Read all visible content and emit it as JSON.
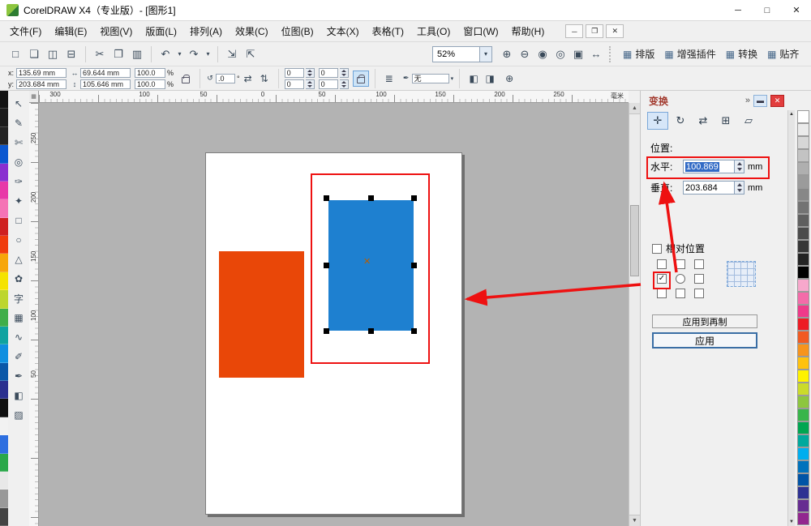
{
  "colors": {
    "annotation": "#ee1111",
    "selection": "#316ac5",
    "blue-shape": "#1e80d0",
    "orange-shape": "#e94708",
    "docker-title": "#a23a2e",
    "apply-border": "#3a6ea5",
    "canvas-bg": "#b3b3b3"
  },
  "titlebar": {
    "title": "CorelDRAW X4（专业版）- [图形1]",
    "minimize_glyph": "─",
    "maximize_glyph": "□",
    "close_glyph": "✕"
  },
  "menubar": {
    "items": [
      {
        "name": "menu-file",
        "label": "文件(F)"
      },
      {
        "name": "menu-edit",
        "label": "编辑(E)"
      },
      {
        "name": "menu-view",
        "label": "视图(V)"
      },
      {
        "name": "menu-layout",
        "label": "版面(L)"
      },
      {
        "name": "menu-arrange",
        "label": "排列(A)"
      },
      {
        "name": "menu-effects",
        "label": "效果(C)"
      },
      {
        "name": "menu-bitmaps",
        "label": "位图(B)"
      },
      {
        "name": "menu-text",
        "label": "文本(X)"
      },
      {
        "name": "menu-table",
        "label": "表格(T)"
      },
      {
        "name": "menu-tools",
        "label": "工具(O)"
      },
      {
        "name": "menu-window",
        "label": "窗口(W)"
      },
      {
        "name": "menu-help",
        "label": "帮助(H)"
      }
    ],
    "doc_controls": [
      {
        "name": "doc-minimize-button",
        "glyph": "─"
      },
      {
        "name": "doc-restore-button",
        "glyph": "❐"
      },
      {
        "name": "doc-close-button",
        "glyph": "✕"
      }
    ]
  },
  "toolbar": {
    "items": [
      {
        "name": "new-button",
        "glyph": "□",
        "cls": "tbtn",
        "inter": "true"
      },
      {
        "name": "open-button",
        "glyph": "❏",
        "cls": "tbtn",
        "inter": "true"
      },
      {
        "name": "save-button",
        "glyph": "◫",
        "cls": "tbtn",
        "inter": "true"
      },
      {
        "name": "print-button",
        "glyph": "⊟",
        "cls": "tbtn",
        "inter": "true"
      },
      {
        "name": "toolbar-separator",
        "glyph": "",
        "cls": "tsep",
        "inter": "false"
      },
      {
        "name": "cut-button",
        "glyph": "✂",
        "cls": "tbtn",
        "inter": "true"
      },
      {
        "name": "copy-button",
        "glyph": "❐",
        "cls": "tbtn",
        "inter": "true"
      },
      {
        "name": "paste-button",
        "glyph": "▥",
        "cls": "tbtn",
        "inter": "true"
      },
      {
        "name": "toolbar-separator",
        "glyph": "",
        "cls": "tsep",
        "inter": "false"
      },
      {
        "name": "undo-button",
        "glyph": "↶",
        "cls": "tbtn",
        "inter": "true"
      },
      {
        "name": "undo-caret",
        "glyph": "▾",
        "cls": "tbtn narrow",
        "inter": "true"
      },
      {
        "name": "redo-button",
        "glyph": "↷",
        "cls": "tbtn",
        "inter": "true"
      },
      {
        "name": "redo-caret",
        "glyph": "▾",
        "cls": "tbtn narrow",
        "inter": "true"
      },
      {
        "name": "toolbar-separator",
        "glyph": "",
        "cls": "tsep",
        "inter": "false"
      },
      {
        "name": "import-button",
        "glyph": "⇲",
        "cls": "tbtn",
        "inter": "true"
      },
      {
        "name": "export-button",
        "glyph": "⇱",
        "cls": "tbtn",
        "inter": "true"
      }
    ],
    "zoom_value": "52%",
    "zoom_items": [
      {
        "name": "zoom-in-button",
        "glyph": "⊕"
      },
      {
        "name": "zoom-out-button",
        "glyph": "⊖"
      },
      {
        "name": "zoom-actual-button",
        "glyph": "◉"
      },
      {
        "name": "zoom-selected-button",
        "glyph": "◎"
      },
      {
        "name": "zoom-page-button",
        "glyph": "▣"
      },
      {
        "name": "zoom-width-button",
        "glyph": "↔"
      }
    ],
    "text_buttons": [
      {
        "name": "layout-button",
        "label": "排版",
        "glyph": "▦"
      },
      {
        "name": "plugins-button",
        "label": "增强插件",
        "glyph": "▦"
      },
      {
        "name": "convert-button",
        "label": "转换",
        "glyph": "▦"
      },
      {
        "name": "snap-button",
        "label": "贴齐",
        "glyph": "▦"
      }
    ]
  },
  "property_bar": {
    "x_label": "x:",
    "x_value": "135.69 mm",
    "y_label": "y:",
    "y_value": "203.684 mm",
    "width_icon": "↔",
    "width_value": "69.644 mm",
    "height_icon": "↕",
    "height_value": "105.646 mm",
    "scale_h": "100.0",
    "scale_v": "100.0",
    "percent": "%",
    "angle_icon": "↺",
    "angle_value": ".0",
    "degree": "°",
    "mirror_h_glyph": "⇄",
    "mirror_v_glyph": "⇅",
    "corner_values": [
      "0",
      "0",
      "0",
      "0"
    ],
    "wrap_glyph": "≣",
    "outline_pen_glyph": "✒",
    "outline_value": "无",
    "fill_glyph": "◧",
    "outline_color_glyph": "◨",
    "quick_glyph": "⊕"
  },
  "toolbox": {
    "tools": [
      {
        "name": "pick-tool",
        "glyph": "↖"
      },
      {
        "name": "shape-tool",
        "glyph": "✎"
      },
      {
        "name": "crop-tool",
        "glyph": "✄"
      },
      {
        "name": "zoom-tool",
        "glyph": "◎"
      },
      {
        "name": "freehand-tool",
        "glyph": "✑"
      },
      {
        "name": "smart-fill-tool",
        "glyph": "✦"
      },
      {
        "name": "rectangle-tool",
        "glyph": "□"
      },
      {
        "name": "ellipse-tool",
        "glyph": "○"
      },
      {
        "name": "polygon-tool",
        "glyph": "△"
      },
      {
        "name": "basic-shapes-tool",
        "glyph": "✿"
      },
      {
        "name": "text-tool",
        "glyph": "字"
      },
      {
        "name": "table-tool",
        "glyph": "▦"
      },
      {
        "name": "blend-tool",
        "glyph": "∿"
      },
      {
        "name": "eyedropper-tool",
        "glyph": "✐"
      },
      {
        "name": "outline-tool",
        "glyph": "✒"
      },
      {
        "name": "fill-tool",
        "glyph": "◧"
      },
      {
        "name": "interactive-fill-tool",
        "glyph": "▨"
      }
    ]
  },
  "rulers": {
    "h_labels": [
      "100",
      "50",
      "0",
      "50",
      "100",
      "150",
      "200",
      "250",
      "300"
    ],
    "v_labels": [
      "250",
      "200",
      "150",
      "100",
      "50"
    ],
    "unit": "毫米"
  },
  "docker": {
    "title": "变换",
    "chevron": "»",
    "minimize_glyph": "▬",
    "close_glyph": "✕",
    "tools": [
      {
        "name": "transform-position-button",
        "glyph": "✛",
        "cls": "dtool active"
      },
      {
        "name": "transform-rotate-button",
        "glyph": "↻",
        "cls": "dtool"
      },
      {
        "name": "transform-scale-mirror-button",
        "glyph": "⇄",
        "cls": "dtool"
      },
      {
        "name": "transform-size-button",
        "glyph": "⊞",
        "cls": "dtool"
      },
      {
        "name": "transform-skew-button",
        "glyph": "▱",
        "cls": "dtool"
      }
    ],
    "position_label": "位置:",
    "h_label": "水平:",
    "h_value": "100.869",
    "h_unit": "mm",
    "v_label": "垂直:",
    "v_value": "203.684",
    "v_unit": "mm",
    "relative_label": "相对位置",
    "anchor_cells": [
      {
        "cls": "acell cb",
        "mark": ""
      },
      {
        "cls": "acell cb",
        "mark": ""
      },
      {
        "cls": "acell cb",
        "mark": ""
      },
      {
        "cls": "acell cb checked",
        "mark": "✓"
      },
      {
        "cls": "acell radio",
        "mark": ""
      },
      {
        "cls": "acell cb",
        "mark": ""
      },
      {
        "cls": "acell cb",
        "mark": ""
      },
      {
        "cls": "acell cb",
        "mark": ""
      },
      {
        "cls": "acell cb",
        "mark": ""
      }
    ],
    "apply_duplicate_label": "应用到再制",
    "apply_label": "应用"
  },
  "palettes": {
    "left": [
      "#141414",
      "#1c1c1c",
      "#242424",
      "#0a57d0",
      "#8a2fd0",
      "#e838a8",
      "#f573b5",
      "#cf2020",
      "#f03c0c",
      "#f7a60a",
      "#f5e300",
      "#bdd62e",
      "#3fae49",
      "#0fa3a0",
      "#0f8fe0",
      "#0a57a8",
      "#2a2f8f",
      "#101010",
      "#f2f2f2",
      "#2e6fe0",
      "#2aa84a",
      "#e8e8e8",
      "#999999",
      "#444444"
    ],
    "right": [
      "#ffffff",
      "#ebebeb",
      "#d7d7d7",
      "#c3c3c3",
      "#afafaf",
      "#9b9b9b",
      "#878787",
      "#737373",
      "#5f5f5f",
      "#4b4b4b",
      "#373737",
      "#232323",
      "#000000",
      "#f7a8cc",
      "#f46ba9",
      "#ef3a8a",
      "#ed1c24",
      "#f15a22",
      "#f7941d",
      "#ffc20e",
      "#fff200",
      "#cbdb2a",
      "#8dc63f",
      "#39b54a",
      "#00a651",
      "#00a99d",
      "#00aeef",
      "#0072bc",
      "#0054a6",
      "#2e3192",
      "#662d91",
      "#92278f"
    ]
  }
}
